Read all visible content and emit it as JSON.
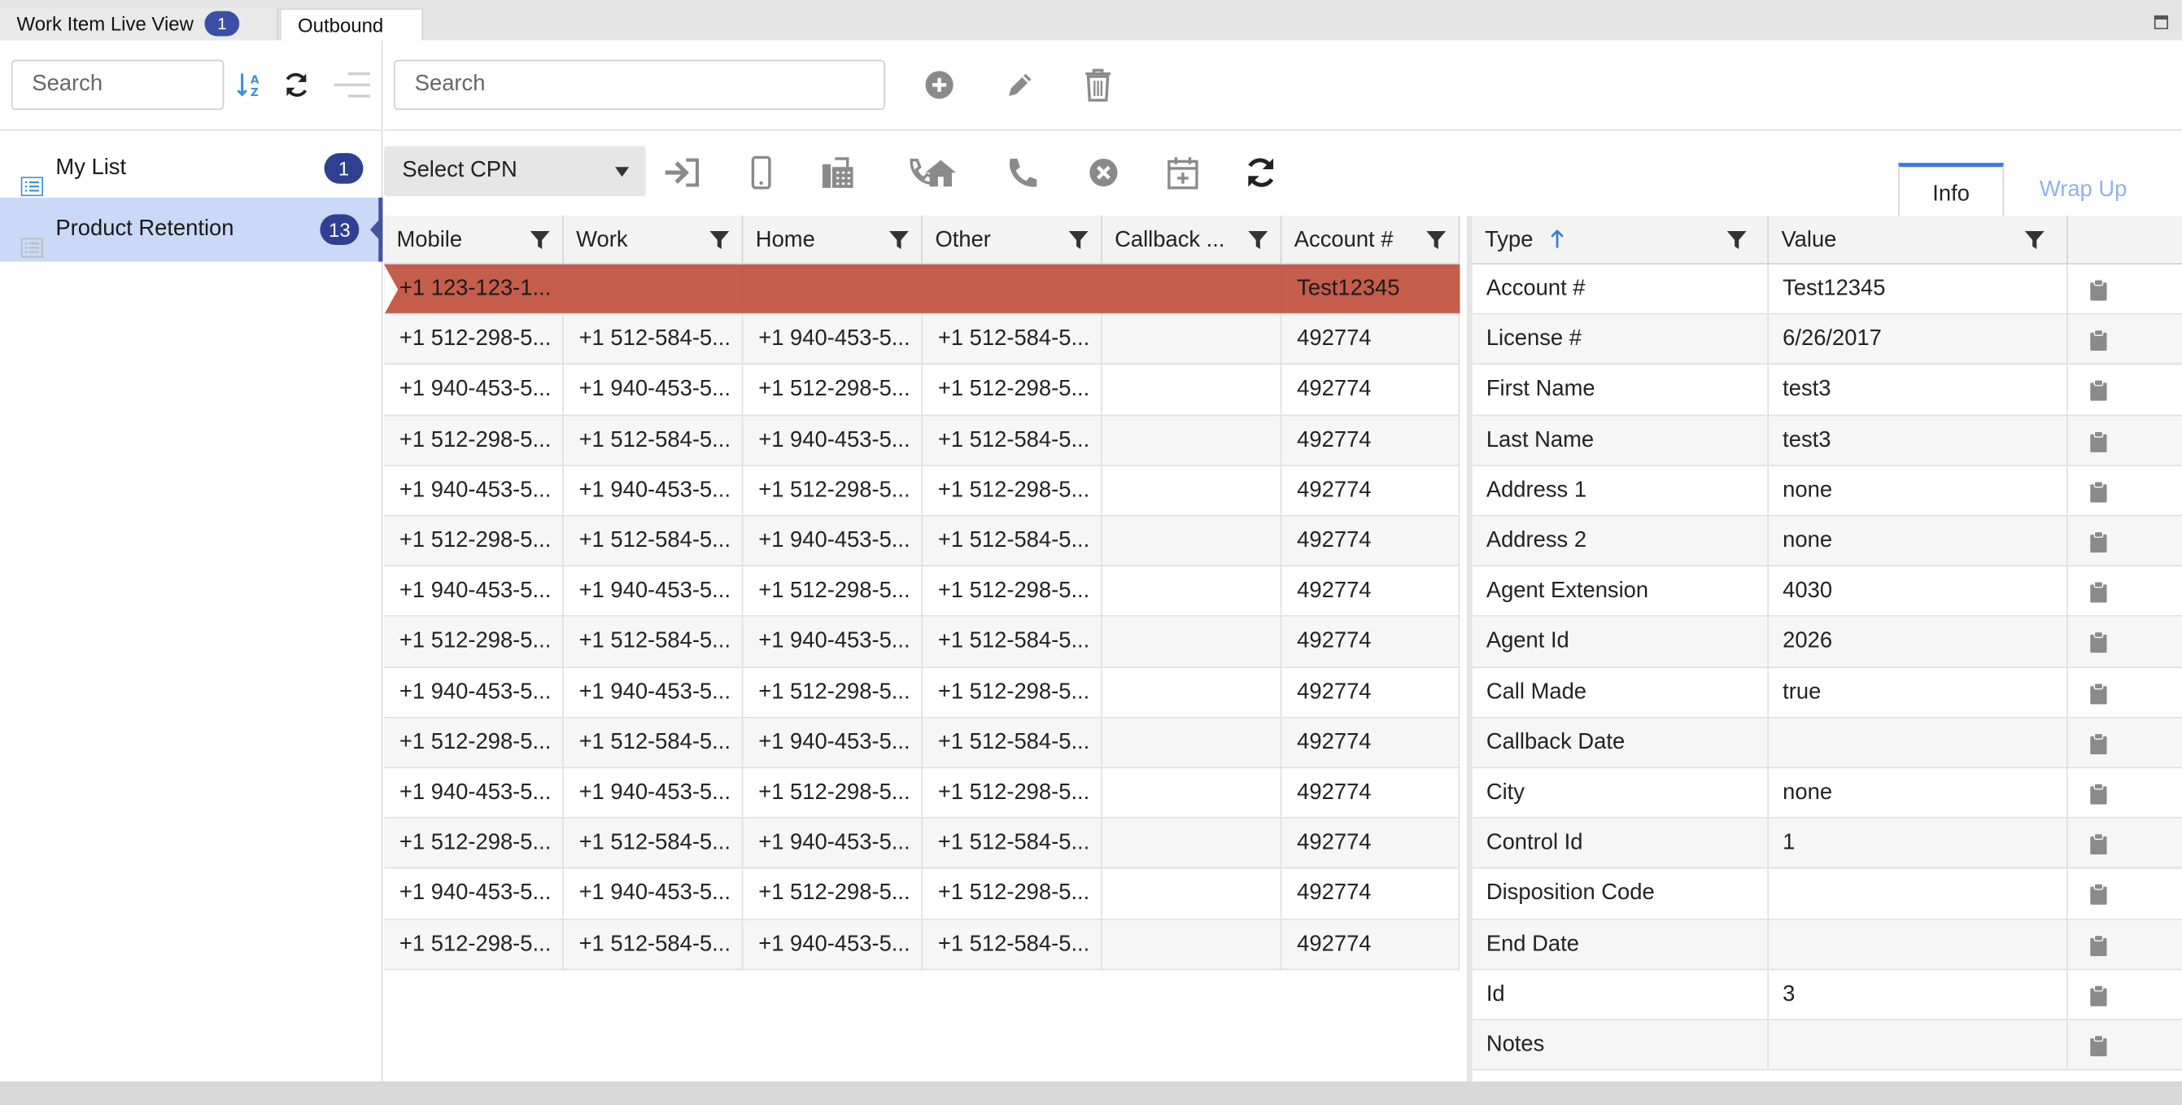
{
  "top_tabs": [
    {
      "label": "Work Item Live View",
      "badge": "1"
    },
    {
      "label": "Outbound"
    }
  ],
  "left_panel": {
    "search_placeholder": "Search",
    "icons": [
      "sort-az-icon",
      "refresh-icon",
      "menu-lines-icon"
    ],
    "lists": [
      {
        "label": "My List",
        "count": "1",
        "selected": false
      },
      {
        "label": "Product Retention",
        "count": "13",
        "selected": true
      }
    ]
  },
  "toolbar": {
    "search_placeholder": "Search",
    "icons": [
      "add-icon",
      "edit-pencil-icon",
      "delete-trash-icon"
    ]
  },
  "action_bar": {
    "cpn_select_label": "Select CPN",
    "icons": [
      "login-arrow-icon",
      "mobile-phone-icon",
      "fax-icon",
      "call-home-icon",
      "phone-icon",
      "cancel-circle-icon",
      "calendar-add-icon",
      "refresh-icon"
    ]
  },
  "info_tabs": [
    {
      "label": "Info",
      "active": true
    },
    {
      "label": "Wrap Up",
      "active": false
    }
  ],
  "grid": {
    "columns": [
      "Mobile",
      "Work",
      "Home",
      "Other",
      "Callback ...",
      "Account #"
    ],
    "rows": [
      [
        "+1 123-123-1...",
        "",
        "",
        "",
        "",
        "Test12345"
      ],
      [
        "+1 512-298-5...",
        "+1 512-584-5...",
        "+1 940-453-5...",
        "+1 512-584-5...",
        "",
        "492774"
      ],
      [
        "+1 940-453-5...",
        "+1 940-453-5...",
        "+1 512-298-5...",
        "+1 512-298-5...",
        "",
        "492774"
      ],
      [
        "+1 512-298-5...",
        "+1 512-584-5...",
        "+1 940-453-5...",
        "+1 512-584-5...",
        "",
        "492774"
      ],
      [
        "+1 940-453-5...",
        "+1 940-453-5...",
        "+1 512-298-5...",
        "+1 512-298-5...",
        "",
        "492774"
      ],
      [
        "+1 512-298-5...",
        "+1 512-584-5...",
        "+1 940-453-5...",
        "+1 512-584-5...",
        "",
        "492774"
      ],
      [
        "+1 940-453-5...",
        "+1 940-453-5...",
        "+1 512-298-5...",
        "+1 512-298-5...",
        "",
        "492774"
      ],
      [
        "+1 512-298-5...",
        "+1 512-584-5...",
        "+1 940-453-5...",
        "+1 512-584-5...",
        "",
        "492774"
      ],
      [
        "+1 940-453-5...",
        "+1 940-453-5...",
        "+1 512-298-5...",
        "+1 512-298-5...",
        "",
        "492774"
      ],
      [
        "+1 512-298-5...",
        "+1 512-584-5...",
        "+1 940-453-5...",
        "+1 512-584-5...",
        "",
        "492774"
      ],
      [
        "+1 940-453-5...",
        "+1 940-453-5...",
        "+1 512-298-5...",
        "+1 512-298-5...",
        "",
        "492774"
      ],
      [
        "+1 512-298-5...",
        "+1 512-584-5...",
        "+1 940-453-5...",
        "+1 512-584-5...",
        "",
        "492774"
      ],
      [
        "+1 940-453-5...",
        "+1 940-453-5...",
        "+1 512-298-5...",
        "+1 512-298-5...",
        "",
        "492774"
      ],
      [
        "+1 512-298-5...",
        "+1 512-584-5...",
        "+1 940-453-5...",
        "+1 512-584-5...",
        "",
        "492774"
      ]
    ],
    "selected_row_color": "#c45d4c"
  },
  "info_grid": {
    "columns": [
      "Type",
      "Value"
    ],
    "sort_indicator": "sort-ascending-icon",
    "rows": [
      {
        "type": "Account #",
        "value": "Test12345"
      },
      {
        "type": "License #",
        "value": "6/26/2017"
      },
      {
        "type": "First Name",
        "value": "test3"
      },
      {
        "type": "Last Name",
        "value": "test3"
      },
      {
        "type": "Address 1",
        "value": "none"
      },
      {
        "type": "Address 2",
        "value": "none"
      },
      {
        "type": "Agent Extension",
        "value": "4030"
      },
      {
        "type": "Agent Id",
        "value": "2026"
      },
      {
        "type": "Call Made",
        "value": "true"
      },
      {
        "type": "Callback Date",
        "value": ""
      },
      {
        "type": "City",
        "value": "none"
      },
      {
        "type": "Control Id",
        "value": "1"
      },
      {
        "type": "Disposition Code",
        "value": ""
      },
      {
        "type": "End Date",
        "value": ""
      },
      {
        "type": "Id",
        "value": "3"
      },
      {
        "type": "Notes",
        "value": ""
      }
    ]
  },
  "colors": {
    "badge": "#2f3f91",
    "selected_list": "#c9d9f7",
    "accent": "#3d7bd6"
  }
}
